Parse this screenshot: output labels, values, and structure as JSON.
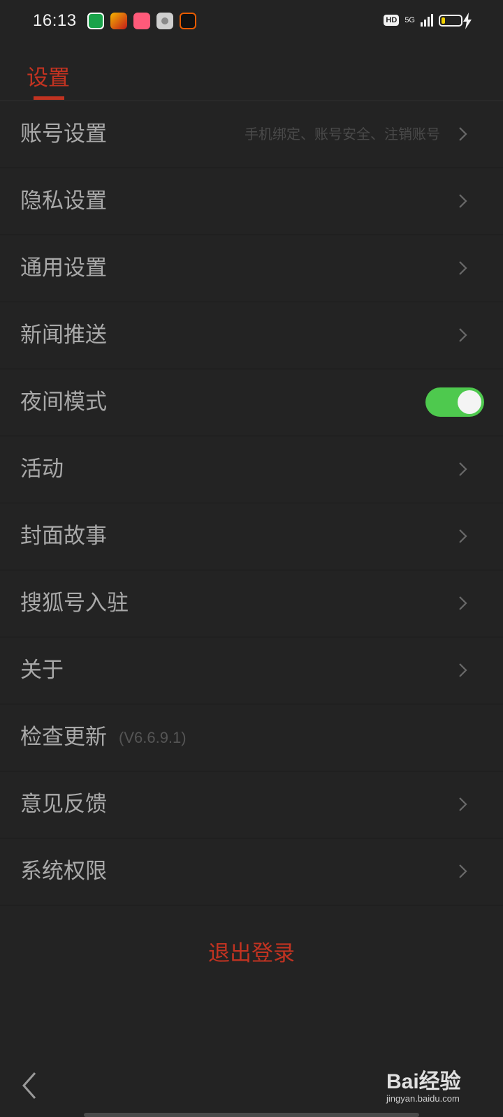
{
  "status_bar": {
    "time": "16:13",
    "hd_label": "HD",
    "network": "5G",
    "battery_percent": 20,
    "app_icons": [
      "video-app-icon",
      "sohu-app-icon",
      "camera-app-icon",
      "settings-app-icon",
      "orange-app-icon"
    ]
  },
  "header": {
    "tab_label": "设置"
  },
  "settings": {
    "items": [
      {
        "label": "账号设置",
        "sub": "手机绑定、账号安全、注销账号",
        "type": "link"
      },
      {
        "label": "隐私设置",
        "type": "link"
      },
      {
        "label": "通用设置",
        "type": "link"
      },
      {
        "label": "新闻推送",
        "type": "link"
      },
      {
        "label": "夜间模式",
        "type": "toggle",
        "on": true
      },
      {
        "label": "活动",
        "type": "link"
      },
      {
        "label": "封面故事",
        "type": "link"
      },
      {
        "label": "搜狐号入驻",
        "type": "link"
      },
      {
        "label": "关于",
        "type": "link"
      },
      {
        "label": "检查更新",
        "version": "(V6.6.9.1)",
        "type": "info"
      },
      {
        "label": "意见反馈",
        "type": "link"
      },
      {
        "label": "系统权限",
        "type": "link"
      }
    ]
  },
  "logout_label": "退出登录",
  "watermark": {
    "main": "Bai经验",
    "sub": "jingyan.baidu.com"
  },
  "colors": {
    "accent": "#c23321",
    "toggle_on": "#4ec94e",
    "background": "#232323"
  }
}
